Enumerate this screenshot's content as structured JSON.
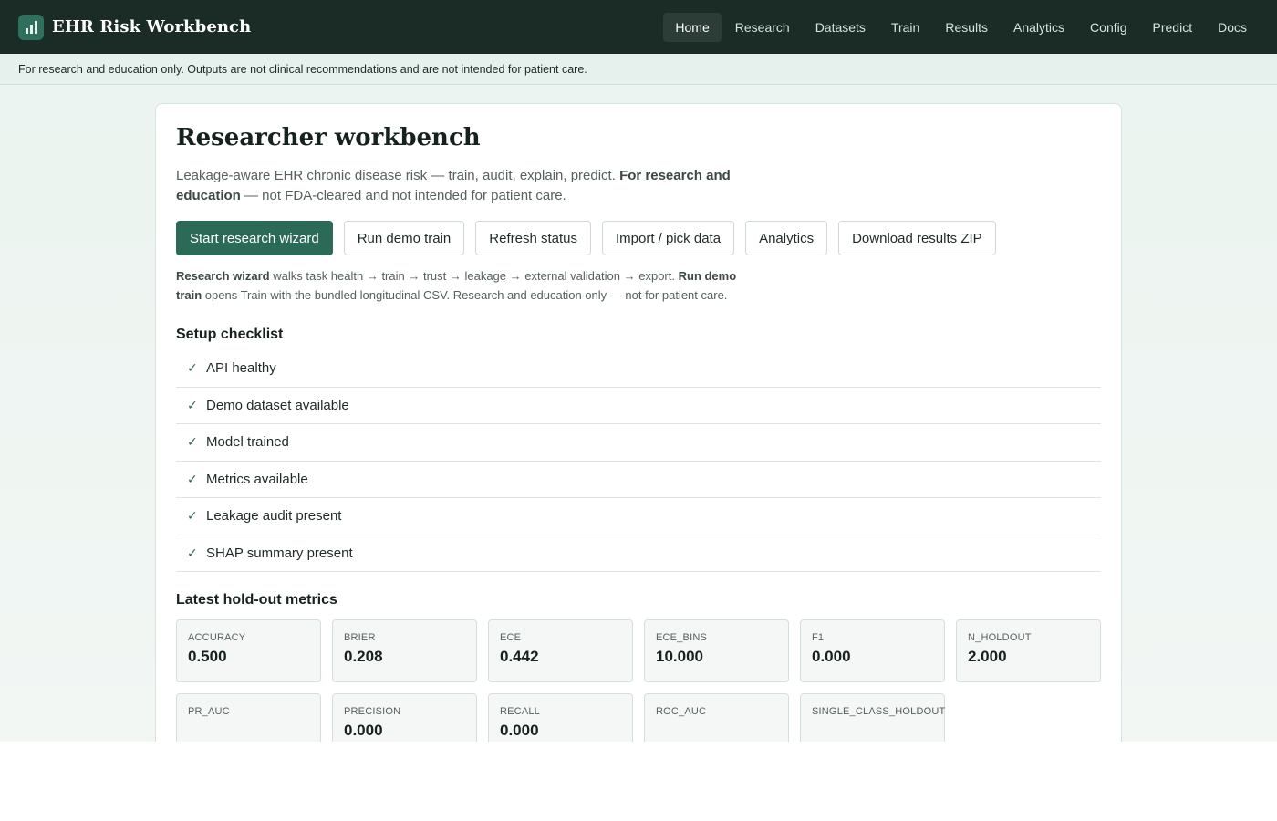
{
  "brand": {
    "title": "EHR Risk Workbench",
    "icon": "bar-chart-icon"
  },
  "nav": [
    {
      "label": "Home",
      "active": true
    },
    {
      "label": "Research"
    },
    {
      "label": "Datasets"
    },
    {
      "label": "Train"
    },
    {
      "label": "Results"
    },
    {
      "label": "Analytics"
    },
    {
      "label": "Config"
    },
    {
      "label": "Predict"
    },
    {
      "label": "Docs"
    }
  ],
  "disclaimer": "For research and education only. Outputs are not clinical recommendations and are not intended for patient care.",
  "page": {
    "title": "Researcher workbench",
    "lead_text": "Leakage-aware EHR chronic disease risk — train, audit, explain, predict.",
    "lead_bold": "For research and education",
    "lead_tail": "— not FDA-cleared and not intended for patient care."
  },
  "actions": {
    "wizard": "Start research wizard",
    "demo": "Run demo train",
    "refresh": "Refresh status",
    "import": "Import / pick data",
    "analytics": "Analytics",
    "download": "Download results ZIP"
  },
  "hint": {
    "wizard_bold": "Research wizard",
    "wizard_text": "walks task health → train → trust → leakage → external validation → export.",
    "demo_bold": "Run demo train",
    "demo_text": "opens Train with the bundled longitudinal CSV. Research and education only — not for patient care."
  },
  "checklist": {
    "title": "Setup checklist",
    "mark": "✓",
    "items": [
      "API healthy",
      "Demo dataset available",
      "Model trained",
      "Metrics available",
      "Leakage audit present",
      "SHAP summary present"
    ]
  },
  "metrics": {
    "title": "Latest hold-out metrics",
    "items": [
      {
        "label": "ACCURACY",
        "value": "0.500"
      },
      {
        "label": "BRIER",
        "value": "0.208"
      },
      {
        "label": "ECE",
        "value": "0.442"
      },
      {
        "label": "ECE_BINS",
        "value": "10.000"
      },
      {
        "label": "F1",
        "value": "0.000"
      },
      {
        "label": "N_HOLDOUT",
        "value": "2.000"
      },
      {
        "label": "PR_AUC",
        "value": ""
      },
      {
        "label": "PRECISION",
        "value": "0.000"
      },
      {
        "label": "RECALL",
        "value": "0.000"
      },
      {
        "label": "ROC_AUC",
        "value": ""
      },
      {
        "label": "SINGLE_CLASS_HOLDOUT",
        "value": ""
      }
    ]
  },
  "colors": {
    "topbar": "#1b2b26",
    "primary": "#2a6a57",
    "accent_check": "#2a6a57"
  }
}
